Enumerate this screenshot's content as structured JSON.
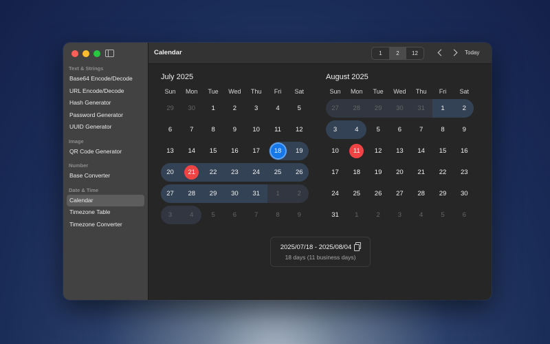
{
  "toolbar": {
    "title": "Calendar",
    "view_options": [
      "1",
      "2",
      "12"
    ],
    "view_selected": "2",
    "today_label": "Today"
  },
  "sidebar": {
    "sections": [
      {
        "title": "Text & Strings",
        "items": [
          "Base64 Encode/Decode",
          "URL Encode/Decode",
          "Hash Generator",
          "Password Generator",
          "UUID Generator"
        ]
      },
      {
        "title": "Image",
        "items": [
          "QR Code Generator"
        ]
      },
      {
        "title": "Number",
        "items": [
          "Base Converter"
        ]
      },
      {
        "title": "Date & Time",
        "items": [
          "Calendar",
          "Timezone Table",
          "Timezone Converter"
        ]
      }
    ],
    "active_item": "Calendar"
  },
  "weekdays": [
    "Sun",
    "Mon",
    "Tue",
    "Wed",
    "Thu",
    "Fri",
    "Sat"
  ],
  "months": [
    {
      "title": "July 2025",
      "weeks": [
        [
          "29",
          "30",
          "1",
          "2",
          "3",
          "4",
          "5"
        ],
        [
          "6",
          "7",
          "8",
          "9",
          "10",
          "11",
          "12"
        ],
        [
          "13",
          "14",
          "15",
          "16",
          "17",
          "18",
          "19"
        ],
        [
          "20",
          "21",
          "22",
          "23",
          "24",
          "25",
          "26"
        ],
        [
          "27",
          "28",
          "29",
          "30",
          "31",
          "1",
          "2"
        ],
        [
          "3",
          "4",
          "5",
          "6",
          "7",
          "8",
          "9"
        ]
      ],
      "muted": [
        [
          0,
          0
        ],
        [
          0,
          1
        ],
        [
          4,
          5
        ],
        [
          4,
          6
        ],
        [
          5,
          0
        ],
        [
          5,
          1
        ],
        [
          5,
          2
        ],
        [
          5,
          3
        ],
        [
          5,
          4
        ],
        [
          5,
          5
        ],
        [
          5,
          6
        ]
      ],
      "selected": [
        2,
        5
      ],
      "today": [
        3,
        1
      ],
      "range_rows": [
        {
          "row": 2,
          "from": 5,
          "to": 6,
          "dim": false
        },
        {
          "row": 3,
          "from": 0,
          "to": 6,
          "dim": false
        },
        {
          "row": 4,
          "from": 0,
          "to": 4,
          "dim": false,
          "joinRight": true
        },
        {
          "row": 4,
          "from": 5,
          "to": 6,
          "dim": true,
          "joinLeft": true
        },
        {
          "row": 5,
          "from": 0,
          "to": 1,
          "dim": true
        }
      ]
    },
    {
      "title": "August 2025",
      "weeks": [
        [
          "27",
          "28",
          "29",
          "30",
          "31",
          "1",
          "2"
        ],
        [
          "3",
          "4",
          "5",
          "6",
          "7",
          "8",
          "9"
        ],
        [
          "10",
          "11",
          "12",
          "13",
          "14",
          "15",
          "16"
        ],
        [
          "17",
          "18",
          "19",
          "20",
          "21",
          "22",
          "23"
        ],
        [
          "24",
          "25",
          "26",
          "27",
          "28",
          "29",
          "30"
        ],
        [
          "31",
          "1",
          "2",
          "3",
          "4",
          "5",
          "6"
        ]
      ],
      "muted": [
        [
          0,
          0
        ],
        [
          0,
          1
        ],
        [
          0,
          2
        ],
        [
          0,
          3
        ],
        [
          0,
          4
        ],
        [
          5,
          1
        ],
        [
          5,
          2
        ],
        [
          5,
          3
        ],
        [
          5,
          4
        ],
        [
          5,
          5
        ],
        [
          5,
          6
        ]
      ],
      "selected": null,
      "today": [
        2,
        1
      ],
      "range_rows": [
        {
          "row": 0,
          "from": 0,
          "to": 4,
          "dim": true,
          "joinRight": true
        },
        {
          "row": 0,
          "from": 5,
          "to": 6,
          "dim": false,
          "joinLeft": true
        },
        {
          "row": 1,
          "from": 0,
          "to": 1,
          "dim": false
        }
      ]
    }
  ],
  "summary": {
    "range": "2025/07/18 - 2025/08/04",
    "detail": "18 days (11 business days)"
  },
  "icons": {
    "copy": "copy-icon",
    "prev": "chevron-left-icon",
    "next": "chevron-right-icon",
    "sidebar_toggle": "sidebar-toggle-icon"
  },
  "colors": {
    "selected": "#1677e8",
    "today": "#ef4444",
    "range": "#344255"
  }
}
